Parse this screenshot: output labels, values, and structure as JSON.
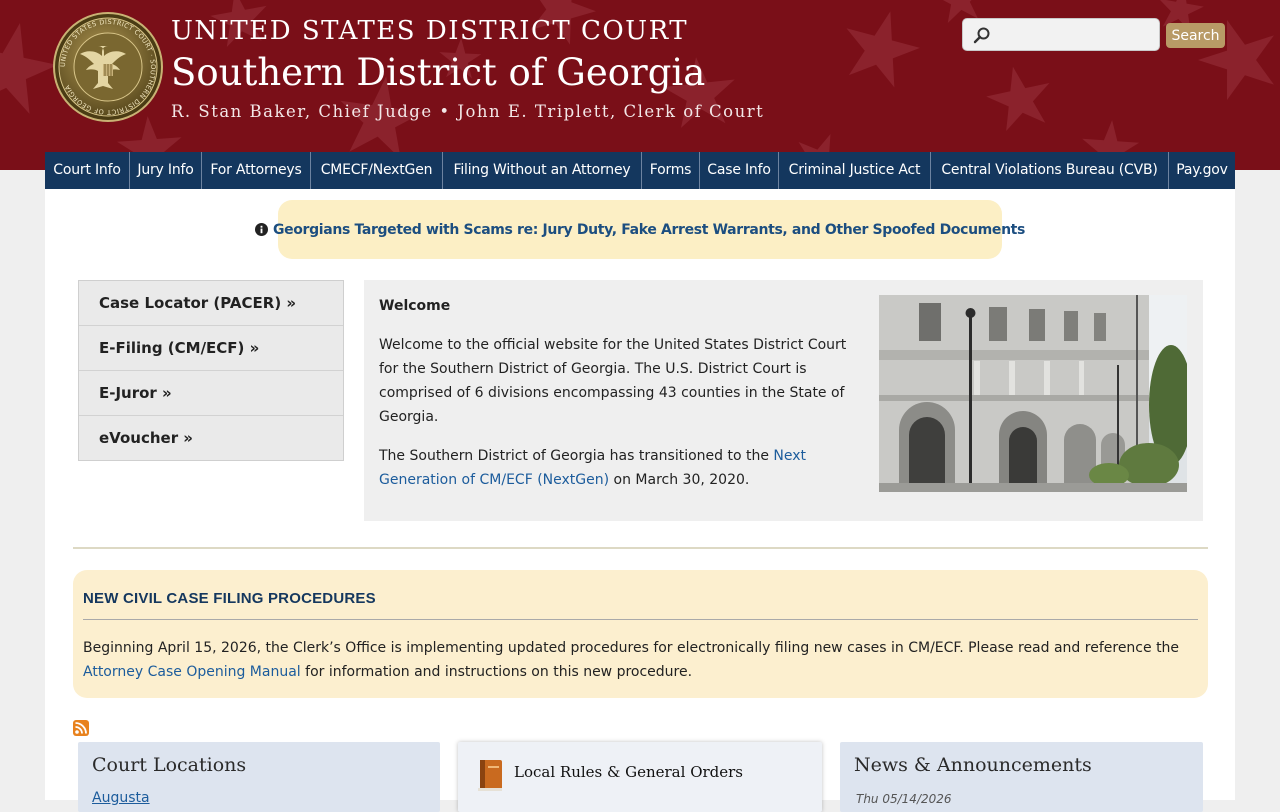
{
  "header": {
    "line1": "UNITED STATES DISTRICT COURT",
    "line2": "Southern District of Georgia",
    "line3": "R. Stan Baker, Chief Judge • John E. Triplett, Clerk of Court",
    "search_placeholder": "",
    "search_button": "Search",
    "seal_text": "UNITED STATES DISTRICT COURT · SOUTHERN DISTRICT OF GEORGIA",
    "colors": {
      "banner": "#7a0f18",
      "search_button": "#b89a66"
    }
  },
  "nav": {
    "color": "#14375e",
    "items": [
      {
        "label": "Court Info"
      },
      {
        "label": "Jury Info"
      },
      {
        "label": "For Attorneys"
      },
      {
        "label": "CMECF/NextGen"
      },
      {
        "label": "Filing Without an Attorney"
      },
      {
        "label": "Forms"
      },
      {
        "label": "Case Info"
      },
      {
        "label": "Criminal Justice Act"
      },
      {
        "label": "Central Violations Bureau (CVB)"
      },
      {
        "label": "Pay.gov"
      }
    ]
  },
  "alert": {
    "icon": "info-circle-icon",
    "text": "Georgians Targeted with Scams re: Jury Duty, Fake Arrest Warrants, and Other Spoofed Documents"
  },
  "quicklinks": [
    {
      "label": "Case Locator (PACER) »"
    },
    {
      "label": "E-Filing (CM/ECF) »"
    },
    {
      "label": "E-Juror »"
    },
    {
      "label": "eVoucher »"
    }
  ],
  "welcome": {
    "title": "Welcome",
    "paragraph1": "Welcome to the official website for the United States District Court for the Southern District of Georgia. The U.S. District Court is comprised of 6 divisions encompassing 43 counties in the State of Georgia.",
    "p2_before": "The Southern District of Georgia has transitioned to the ",
    "p2_link": "Next Generation of CM/ECF (NextGen)",
    "p2_after": " on March 30, 2020."
  },
  "notice": {
    "title": "NEW CIVIL CASE FILING PROCEDURES",
    "text_before": "Beginning April 15, 2026, the Clerk’s Office is implementing updated procedures for electronically filing new cases in CM/ECF.  Please read and reference the ",
    "link": "Attorney Case Opening Manual",
    "text_after": " for information and instructions on this new procedure."
  },
  "cards": {
    "court_locations": {
      "title": "Court Locations",
      "first_link": "Augusta"
    },
    "local_rules": {
      "title": "Local Rules & General Orders",
      "icon": "book-icon"
    },
    "news": {
      "title": "News & Announcements",
      "first_date": "Thu 05/14/2026"
    }
  },
  "rss": {
    "icon": "rss-feed-icon"
  }
}
